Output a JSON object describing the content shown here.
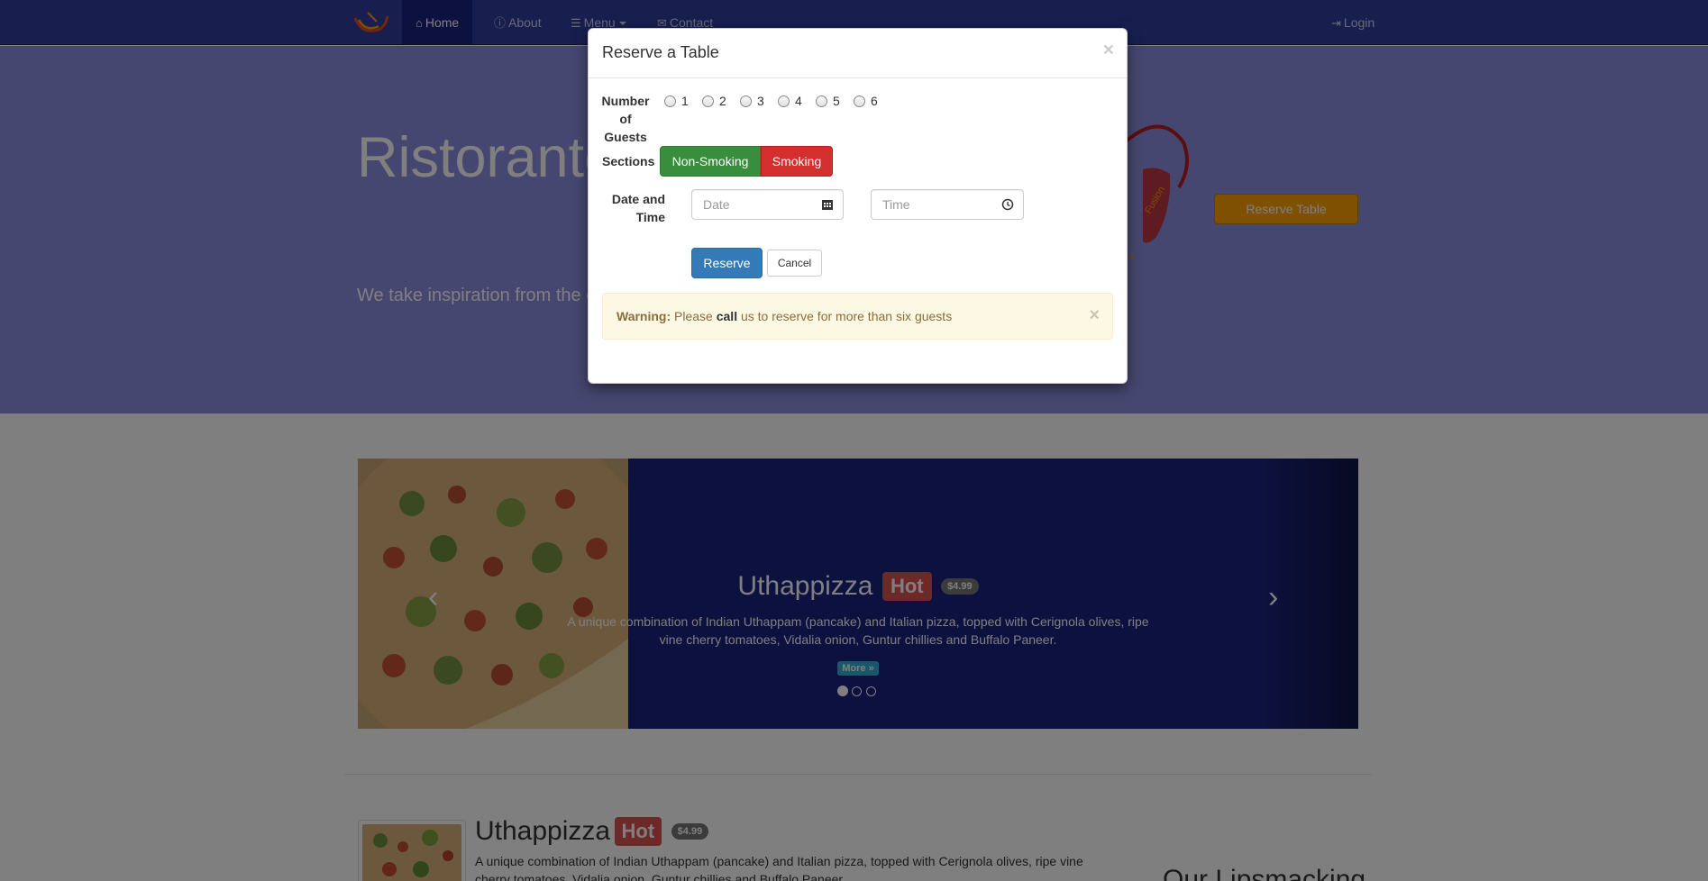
{
  "navbar": {
    "items": [
      {
        "label": "Home",
        "icon": "home-icon",
        "active": true
      },
      {
        "label": "About",
        "icon": "info-icon"
      },
      {
        "label": "Menu",
        "icon": "list-icon"
      },
      {
        "label": "Contact",
        "icon": "envelope-icon"
      }
    ],
    "login": {
      "label": "Login",
      "icon": "login-icon"
    }
  },
  "jumbotron": {
    "title": "Ristorante",
    "text": "We take inspiration from the experience. Our lipsmacking",
    "reserve_label": "Reserve Table"
  },
  "carousel": {
    "title": "Uthappizza",
    "badge": "Hot",
    "price": "$4.99",
    "description": "A unique combination of Indian Uthappam (pancake) and Italian pizza, topped with Cerignola olives, ripe vine cherry tomatoes, Vidalia onion, Guntur chillies and Buffalo Paneer.",
    "more_label": "More »",
    "active_index": 0
  },
  "featured": {
    "title": "Uthappizza",
    "badge": "Hot",
    "price": "$4.99",
    "description": "A unique combination of Indian Uthappam (pancake) and Italian pizza, topped with Cerignola olives, ripe vine cherry tomatoes, Vidalia onion, Guntur chillies and Buffalo Paneer.",
    "side_heading": "Our Lipsmacking"
  },
  "modal": {
    "title": "Reserve a Table",
    "close": "×",
    "guests_label": "Number of Guests",
    "guest_options": [
      "1",
      "2",
      "3",
      "4",
      "5",
      "6"
    ],
    "sections_label": "Sections",
    "non_smoking_label": "Non-Smoking",
    "smoking_label": "Smoking",
    "datetime_label": "Date and Time",
    "date_placeholder": "Date",
    "time_placeholder": "Time",
    "reserve_label": "Reserve",
    "cancel_label": "Cancel",
    "warning": {
      "strong": "Warning:",
      "text_before": "Please",
      "emphasis": "call",
      "text_after": "us to reserve for more than six guests",
      "close": "×"
    }
  },
  "colors": {
    "navbar": "#303f9f",
    "jumbotron": "#8c8fe0",
    "carousel": "#1a237e",
    "reserve_button": "#ffa000",
    "non_smoking": "#388e3c",
    "smoking": "#d32f2f",
    "primary": "#337ab7"
  }
}
